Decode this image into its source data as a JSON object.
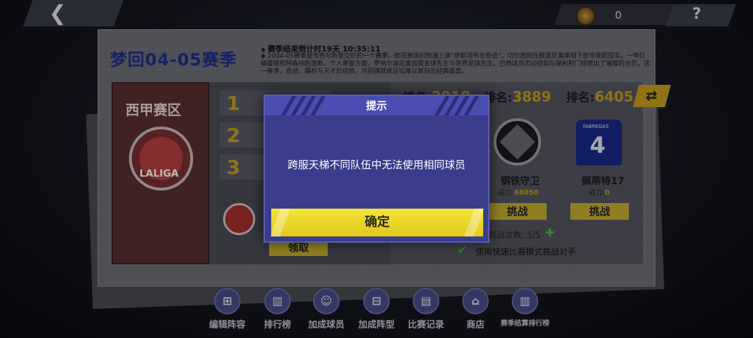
{
  "top_bar": {
    "back_icon": "back-arrow-icon",
    "coin_icon": "coin-icon",
    "coin_count": "0",
    "help_icon": "help-icon",
    "help_glyph": "?"
  },
  "season": {
    "title": "梦回04-05赛季",
    "countdown": "赛季结束倒计时19天 10:35:11",
    "description": "2004-05赛季是传奇与新星交织的一个赛季。欧冠赛场利物浦上演“伊斯坦布尔奇迹”，切尔西则在穆里尼奥率领下首夺英超冠军，一举打破曼联和阿森纳的垄断。个人荣誉方面，罗纳尔迪尼奥加冕金球先生与世界足球先生，巴西球员灵动自如与犀利射门绽放出了璀璨的光芒。这一赛季，奇迹、霸权与天才的绽放，共同铸就成足坛难以复刻的经典篇章。"
  },
  "league": {
    "name": "西甲赛区",
    "logo_text": "LALIGA",
    "ranks": [
      "1",
      "2",
      "3"
    ],
    "claim_label": "领取"
  },
  "opponents": {
    "rank_prefix": "排名:",
    "ranks": [
      "3918",
      "3889",
      "6405"
    ],
    "refresh_icon": "refresh-icon",
    "list": [
      {
        "name": "钢铁守卫",
        "power_label": "战力:",
        "power": "68050",
        "challenge_label": "挑战"
      },
      {
        "name": "佩蒂特17",
        "power_label": "战力:",
        "power": "0",
        "challenge_label": "挑战",
        "jersey_name": "FABREGAS",
        "jersey_number": "4"
      }
    ],
    "attempts": "挑战次数: 5/5",
    "quick_mode_label": "使用快速比赛模式挑战对手"
  },
  "bottom_nav": [
    {
      "label": "编辑阵容",
      "icon": "formation-icon"
    },
    {
      "label": "排行榜",
      "icon": "leaderboard-icon"
    },
    {
      "label": "加成球员",
      "icon": "players-icon"
    },
    {
      "label": "加成阵型",
      "icon": "tactics-icon"
    },
    {
      "label": "比赛记录",
      "icon": "record-icon"
    },
    {
      "label": "商店",
      "icon": "shop-icon"
    },
    {
      "label": "赛季结算排行榜",
      "icon": "season-ranking-icon"
    }
  ],
  "dialog": {
    "title": "提示",
    "message": "跨服天梯不同队伍中无法使用相同球员",
    "confirm_label": "确定"
  }
}
